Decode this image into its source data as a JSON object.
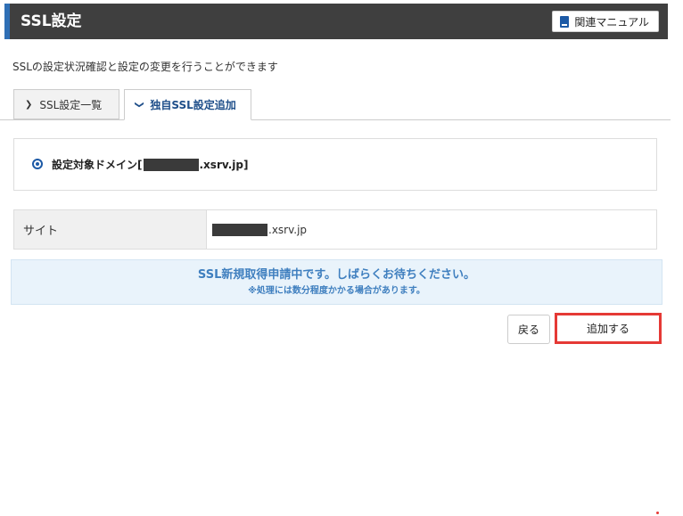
{
  "header": {
    "title": "SSL設定",
    "manual_label": "関連マニュアル",
    "manual_icon": "book-icon"
  },
  "description": "SSLの設定状況確認と設定の変更を行うことができます",
  "tabs": [
    {
      "label": "SSL設定一覧",
      "icon": "chevron-right-icon",
      "active": false
    },
    {
      "label": "独自SSL設定追加",
      "icon": "chevron-down-icon",
      "active": true
    }
  ],
  "domain": {
    "label_prefix": "設定対象ドメイン[",
    "label_suffix": ".xsrv.jp]"
  },
  "site": {
    "label": "サイト",
    "value_suffix": ".xsrv.jp"
  },
  "notice": {
    "main": "SSL新規取得申請中です。しばらくお待ちください。",
    "sub": "※処理には数分程度かかる場合があります。"
  },
  "buttons": {
    "back": "戻る",
    "add": "追加する"
  },
  "colors": {
    "header_bg": "#3f3f3f",
    "header_accent": "#2f6fb5",
    "notice_bg": "#e9f3fb",
    "notice_text": "#3f7fbf",
    "highlight": "#e53935"
  }
}
